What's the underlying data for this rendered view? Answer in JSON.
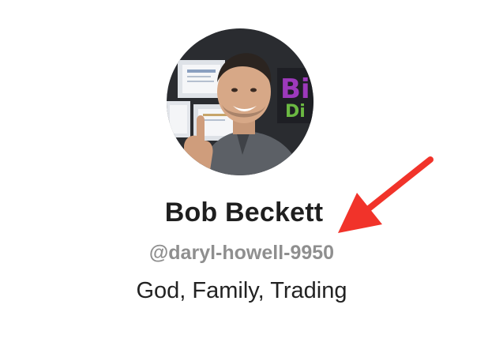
{
  "profile": {
    "avatar_icon": "profile-photo",
    "display_name": "Bob Beckett",
    "handle": "@daryl-howell-9950",
    "bio": "God, Family, Trading"
  },
  "annotation": {
    "arrow_icon": "red-arrow-icon",
    "arrow_color": "#f1332a"
  }
}
